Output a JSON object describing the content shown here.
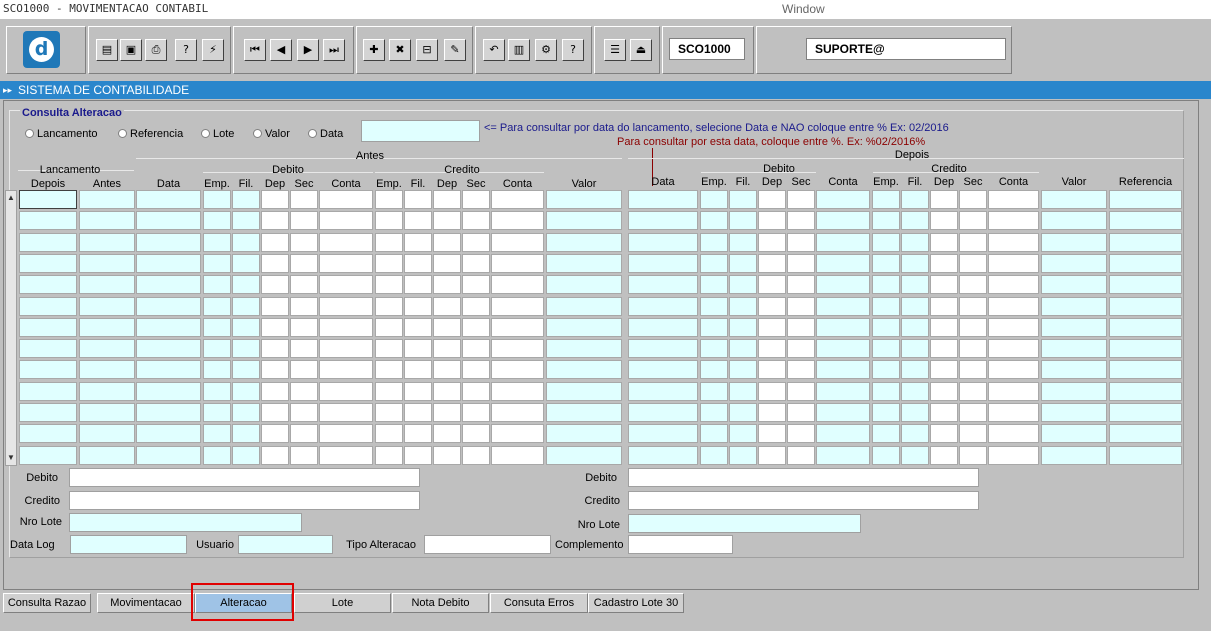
{
  "titlebar": {
    "app_title": "SCO1000 - MOVIMENTACAO CONTABIL",
    "window_label": "Window"
  },
  "toolbar": {
    "logo_letter": "d",
    "buttons": [
      {
        "name": "save-icon",
        "glyph": "▤"
      },
      {
        "name": "window-icon",
        "glyph": "▣"
      },
      {
        "name": "print-icon",
        "glyph": "⎙"
      },
      {
        "name": "query-enter-icon",
        "glyph": "?"
      },
      {
        "name": "query-execute-icon",
        "glyph": "⚡"
      },
      {
        "name": "first-record-icon",
        "glyph": "⏮"
      },
      {
        "name": "previous-record-icon",
        "glyph": "◀"
      },
      {
        "name": "next-record-icon",
        "glyph": "▶"
      },
      {
        "name": "last-record-icon",
        "glyph": "⏭"
      },
      {
        "name": "insert-record-icon",
        "glyph": "✚"
      },
      {
        "name": "delete-record-icon",
        "glyph": "✖"
      },
      {
        "name": "clear-record-icon",
        "glyph": "⊟"
      },
      {
        "name": "edit-icon",
        "glyph": "✎"
      },
      {
        "name": "undo-icon",
        "glyph": "↶"
      },
      {
        "name": "clipboard-icon",
        "glyph": "▥"
      },
      {
        "name": "settings-icon",
        "glyph": "⚙"
      },
      {
        "name": "help-icon",
        "glyph": "?"
      },
      {
        "name": "menu-icon",
        "glyph": "☰"
      },
      {
        "name": "exit-icon",
        "glyph": "⏏"
      }
    ],
    "form_code": "SCO1000",
    "user": "SUPORTE@"
  },
  "system_title": "SISTEMA DE CONTABILIDADE",
  "section_title": "Consulta Alteracao",
  "radios": [
    "Lancamento",
    "Referencia",
    "Lote",
    "Valor",
    "Data"
  ],
  "hint_blue": "<= Para consultar por data do lancamento, selecione Data e NAO coloque entre % Ex: 02/2016",
  "hint_red": "Para consultar por esta data, coloque entre %. Ex: %02/2016%",
  "group_labels": {
    "antes": "Antes",
    "depois": "Depois",
    "lancamento": "Lancamento",
    "debito_a": "Debito",
    "credito_a": "Credito",
    "debito_d": "Debito",
    "credito_d": "Credito"
  },
  "columns_left": [
    "Depois",
    "Antes",
    "Data",
    "Emp.",
    "Fil.",
    "Dep",
    "Sec",
    "Conta",
    "Emp.",
    "Fil.",
    "Dep",
    "Sec",
    "Conta",
    "Valor"
  ],
  "columns_right": [
    "Data",
    "Emp.",
    "Fil.",
    "Dep",
    "Sec",
    "Conta",
    "Emp.",
    "Fil.",
    "Dep",
    "Sec",
    "Conta",
    "Valor",
    "Referencia"
  ],
  "bottom_left": {
    "debito": "Debito",
    "credito": "Credito",
    "nro_lote": "Nro Lote"
  },
  "bottom_right": {
    "debito": "Debito",
    "credito": "Credito",
    "nro_lote": "Nro Lote"
  },
  "log_row": {
    "data_log": "Data Log",
    "usuario": "Usuario",
    "tipo_alteracao": "Tipo Alteracao",
    "complemento": "Complemento"
  },
  "tabs": [
    "Consulta Razao",
    "Movimentacao",
    "Alteracao",
    "Lote",
    "Nota Debito",
    "Consuta Erros",
    "Cadastro Lote 30"
  ],
  "active_tab": "Alteracao"
}
